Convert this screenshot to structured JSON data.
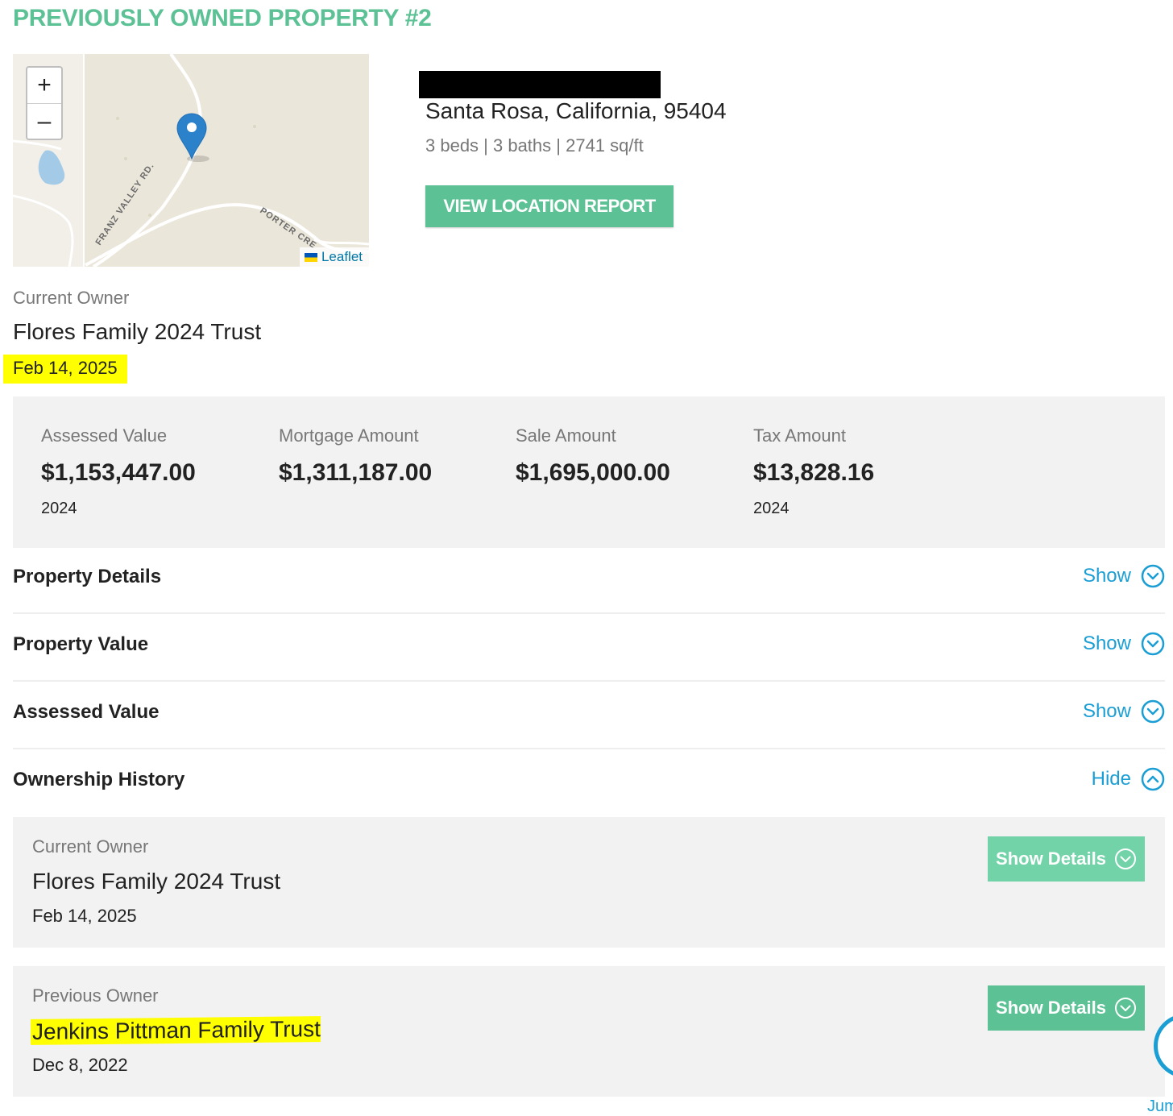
{
  "section_heading": "PREVIOUSLY OWNED PROPERTY #2",
  "map": {
    "zoom_in": "+",
    "zoom_out": "–",
    "road_labels": [
      "FRANZ VALLEY RD.",
      "PORTER CRE"
    ],
    "attribution": "Leaflet"
  },
  "property": {
    "city_line": "Santa Rosa, California, 95404",
    "specs": "3 beds | 3 baths | 2741 sq/ft",
    "location_button": "VIEW LOCATION REPORT"
  },
  "current_owner": {
    "label": "Current Owner",
    "name": "Flores Family 2024 Trust",
    "date": "Feb 14, 2025"
  },
  "stats": [
    {
      "label": "Assessed Value",
      "value": "$1,153,447.00",
      "year": "2024"
    },
    {
      "label": "Mortgage Amount",
      "value": "$1,311,187.00",
      "year": ""
    },
    {
      "label": "Sale Amount",
      "value": "$1,695,000.00",
      "year": ""
    },
    {
      "label": "Tax Amount",
      "value": "$13,828.16",
      "year": "2024"
    }
  ],
  "sections": [
    {
      "title": "Property Details",
      "toggle": "Show",
      "state": "collapsed"
    },
    {
      "title": "Property Value",
      "toggle": "Show",
      "state": "collapsed"
    },
    {
      "title": "Assessed Value",
      "toggle": "Show",
      "state": "collapsed"
    },
    {
      "title": "Ownership History",
      "toggle": "Hide",
      "state": "expanded"
    }
  ],
  "ownership_history": [
    {
      "label": "Current Owner",
      "name": "Flores Family 2024 Trust",
      "date": "Feb 14, 2025",
      "button": "Show Details"
    },
    {
      "label": "Previous Owner",
      "name": "Jenkins Pittman Family Trust",
      "date": "Dec 8, 2022",
      "button": "Show Details"
    }
  ],
  "jump_label": "Jum",
  "colors": {
    "brand_green": "#5cc295",
    "button_light_green": "#72d3a9",
    "link_blue": "#1a9ed4",
    "highlight": "#ffff00",
    "panel_gray": "#f2f2f2"
  }
}
